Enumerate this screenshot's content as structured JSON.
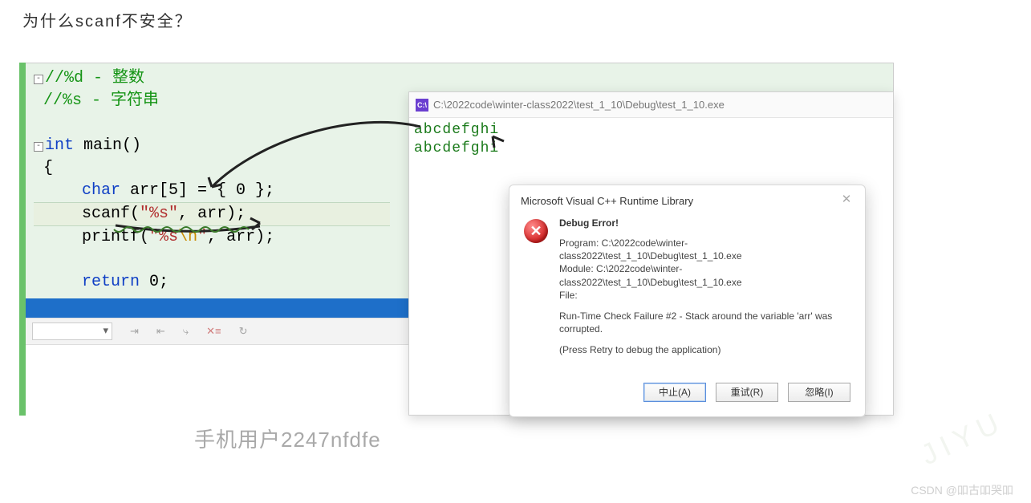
{
  "heading": "为什么scanf不安全？",
  "code": {
    "comment_d": "//%d - 整数",
    "comment_s": "//%s - 字符串",
    "kw_int": "int",
    "fn_main": "main",
    "paren": "()",
    "brace_open": "{",
    "kw_char": "char",
    "arr_decl": " arr[5] = { 0 };",
    "scanf_name": "scanf",
    "scanf_open": "(",
    "scanf_fmt": "\"%s\"",
    "scanf_rest": ", arr);",
    "printf_name": "printf",
    "printf_open": "(",
    "printf_fmt1": "\"%s",
    "printf_esc": "\\n",
    "printf_fmt2": "\"",
    "printf_rest": ", arr);",
    "kw_return": "return",
    "return_rest": " 0;",
    "brace_close": ""
  },
  "console": {
    "title_path": "C:\\2022code\\winter-class2022\\test_1_10\\Debug\\test_1_10.exe",
    "line_input": "abcdefghi",
    "line_output": "abcdefghi"
  },
  "dialog": {
    "title": "Microsoft Visual C++ Runtime Library",
    "heading": "Debug Error!",
    "program_line": "Program: C:\\2022code\\winter-class2022\\test_1_10\\Debug\\test_1_10.exe",
    "module_line": "Module: C:\\2022code\\winter-class2022\\test_1_10\\Debug\\test_1_10.exe",
    "file_line": "File:",
    "failure_line": "Run-Time Check Failure #2 - Stack around the variable 'arr' was corrupted.",
    "press_line": "(Press Retry to debug the application)",
    "btn_abort": "中止(A)",
    "btn_retry": "重试(R)",
    "btn_ignore": "忽略(I)"
  },
  "watermark_user": "手机用户2247nfdfe",
  "watermark_csdn": "CSDN @吅古吅哭吅"
}
